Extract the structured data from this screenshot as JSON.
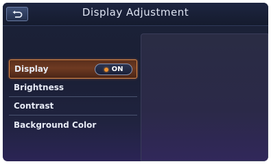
{
  "header": {
    "title": "Display Adjustment",
    "back_icon": "back-arrow-icon"
  },
  "menu": {
    "items": [
      {
        "label": "Display",
        "toggle": {
          "state": "ON",
          "indicator_color": "#f0922f"
        },
        "selected": true
      },
      {
        "label": "Brightness"
      },
      {
        "label": "Contrast"
      },
      {
        "label": "Background Color"
      }
    ]
  },
  "colors": {
    "selection_border": "#d98a4a",
    "selection_fill": "#6e3a22",
    "screen_bg": "#1c2238",
    "text": "#e6eaf4"
  }
}
